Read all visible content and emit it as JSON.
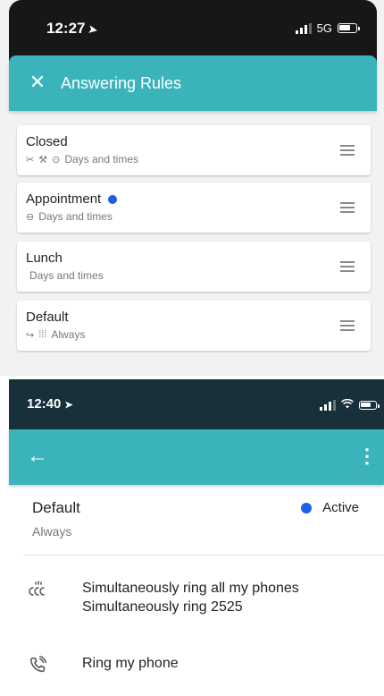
{
  "screen1": {
    "status_bar": {
      "time": "12:27",
      "network": "5G"
    },
    "app_bar": {
      "title": "Answering Rules"
    },
    "rules": [
      {
        "name": "Closed",
        "subtitle": "Days and times",
        "icons": [
          "phone-forward",
          "tools",
          "clock"
        ],
        "active": false
      },
      {
        "name": "Appointment",
        "subtitle": "Days and times",
        "icons": [
          "clock"
        ],
        "active": true
      },
      {
        "name": "Lunch",
        "subtitle": "Days and times",
        "icons": [],
        "active": false
      },
      {
        "name": "Default",
        "subtitle": "Always",
        "icons": [
          "forward-arrow",
          "multi-ring"
        ],
        "active": false
      }
    ]
  },
  "screen2": {
    "status_bar": {
      "time": "12:40"
    },
    "rule": {
      "name": "Default",
      "subtitle": "Always",
      "status": "Active"
    },
    "actions": [
      {
        "icon": "multi-ring",
        "line1": "Simultaneously ring all my phones",
        "line2": "Simultaneously ring 2525"
      },
      {
        "icon": "phone-ringing",
        "line1": "Ring my phone",
        "line2": ""
      }
    ]
  },
  "colors": {
    "accent": "#3ab3ba",
    "active_dot": "#1d63e8",
    "status_dark": "#171717"
  }
}
